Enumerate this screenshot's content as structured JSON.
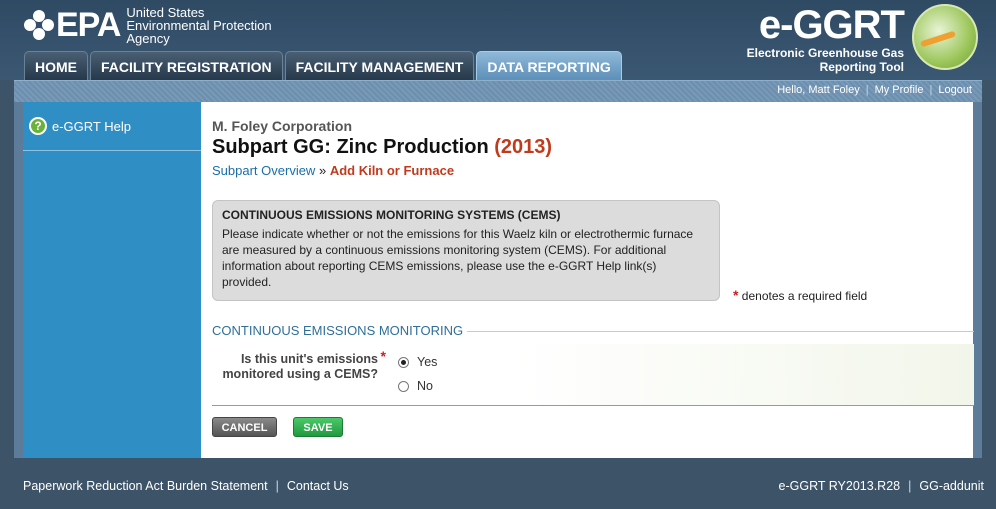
{
  "header": {
    "epa_word": "EPA",
    "agency_line1": "United States",
    "agency_line2": "Environmental Protection",
    "agency_line3": "Agency",
    "tool_name": "e-GGRT",
    "tool_sub1": "Electronic Greenhouse Gas",
    "tool_sub2": "Reporting Tool"
  },
  "nav": {
    "tabs": [
      {
        "label": "HOME"
      },
      {
        "label": "FACILITY REGISTRATION"
      },
      {
        "label": "FACILITY MANAGEMENT"
      },
      {
        "label": "DATA REPORTING"
      }
    ]
  },
  "userbar": {
    "greeting": "Hello, Matt Foley",
    "profile": "My Profile",
    "logout": "Logout",
    "separator": "|"
  },
  "sidebar": {
    "items": [
      {
        "label": "e-GGRT Help",
        "icon": "help-icon",
        "icon_glyph": "?"
      }
    ]
  },
  "main": {
    "company": "M. Foley Corporation",
    "title": "Subpart GG: Zinc Production",
    "year": "(2013)",
    "breadcrumb": {
      "link": "Subpart Overview",
      "sep": "»",
      "current": "Add Kiln or Furnace"
    },
    "infobox": {
      "title": "CONTINUOUS EMISSIONS MONITORING SYSTEMS (CEMS)",
      "text": "Please indicate whether or not the emissions for this Waelz kiln or electrothermic furnace are measured by a continuous emissions monitoring system (CEMS). For additional information about reporting CEMS emissions, please use the e-GGRT Help link(s) provided."
    },
    "required_note": "denotes a required field",
    "asterisk": "*",
    "section_title": "CONTINUOUS EMISSIONS MONITORING",
    "question": "Is this unit's emissions monitored using a CEMS?",
    "options": [
      {
        "label": "Yes",
        "checked": true
      },
      {
        "label": "No",
        "checked": false
      }
    ],
    "buttons": {
      "cancel": "CANCEL",
      "save": "SAVE"
    }
  },
  "footer": {
    "paperwork": "Paperwork Reduction Act Burden Statement",
    "contact": "Contact Us",
    "version": "e-GGRT RY2013.R28",
    "page_id": "GG-addunit",
    "separator": "|"
  }
}
